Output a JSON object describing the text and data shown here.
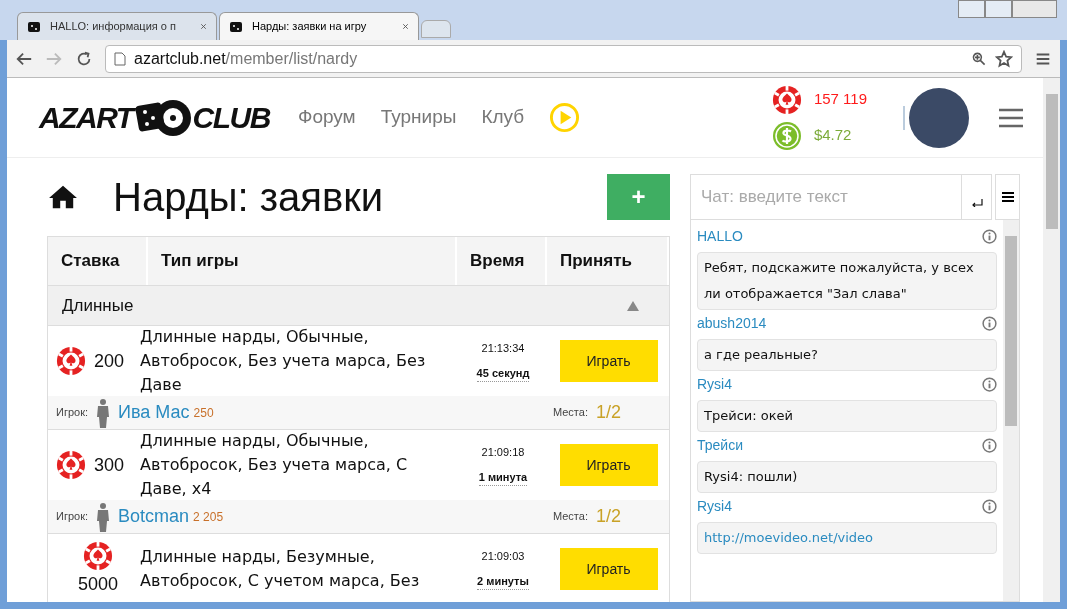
{
  "browser": {
    "tabs": [
      {
        "title": "HALLO: информация о п",
        "selected": false
      },
      {
        "title": "Нарды: заявки на игру",
        "selected": true
      }
    ],
    "url": {
      "domain": "azartclub.net",
      "path": "/member/list/nardy"
    }
  },
  "header": {
    "logo": {
      "left": "AZART",
      "right": "CLUB"
    },
    "nav": [
      "Форум",
      "Турниры",
      "Клуб"
    ],
    "chips": "157 119",
    "money": "$4.72"
  },
  "page": {
    "title": "Нарды: заявки",
    "add_button": "+"
  },
  "table": {
    "columns": [
      "Ставка",
      "Тип игры",
      "Время",
      "Принять"
    ],
    "groups": [
      {
        "name": "Длинные",
        "expanded": true,
        "rows": [
          {
            "stake": "200",
            "game": "Длинные нарды, Обычные, Автобросок, Без учета марса, Без Даве",
            "time": "21:13:34",
            "ago": "45 секунд",
            "action": "Играть",
            "player_label": "Игрок:",
            "player": "Ива Мас",
            "rating": "250",
            "seats_label": "Места:",
            "seats": "1/2"
          },
          {
            "stake": "300",
            "game": "Длинные нарды, Обычные, Автобросок, Без учета марса, С Даве, x4",
            "time": "21:09:18",
            "ago": "1 минута",
            "action": "Играть",
            "player_label": "Игрок:",
            "player": "Botcman",
            "rating": "2 205",
            "seats_label": "Места:",
            "seats": "1/2"
          },
          {
            "stake": "5000",
            "game": "Длинные нарды, Безумные, Автобросок, С учетом марса, Без",
            "time": "21:09:03",
            "ago": "2 минуты",
            "action": "Играть"
          }
        ]
      }
    ]
  },
  "chat": {
    "placeholder": "Чат: введите текст",
    "messages": [
      {
        "author": "HALLO",
        "text": "Ребят, подскажите пожалуйста, у всех ли отображается \"Зал слава\"",
        "kind": "text"
      },
      {
        "author": "abush2014",
        "text": "а где реальные?",
        "kind": "text"
      },
      {
        "author": "Rysi4",
        "text": "Трейси: окей",
        "kind": "text"
      },
      {
        "author": "Трейси",
        "text": "Rysi4: пошли)",
        "kind": "text"
      },
      {
        "author": "Rysi4",
        "text": "http://moevideo.net/video",
        "kind": "link"
      }
    ]
  }
}
